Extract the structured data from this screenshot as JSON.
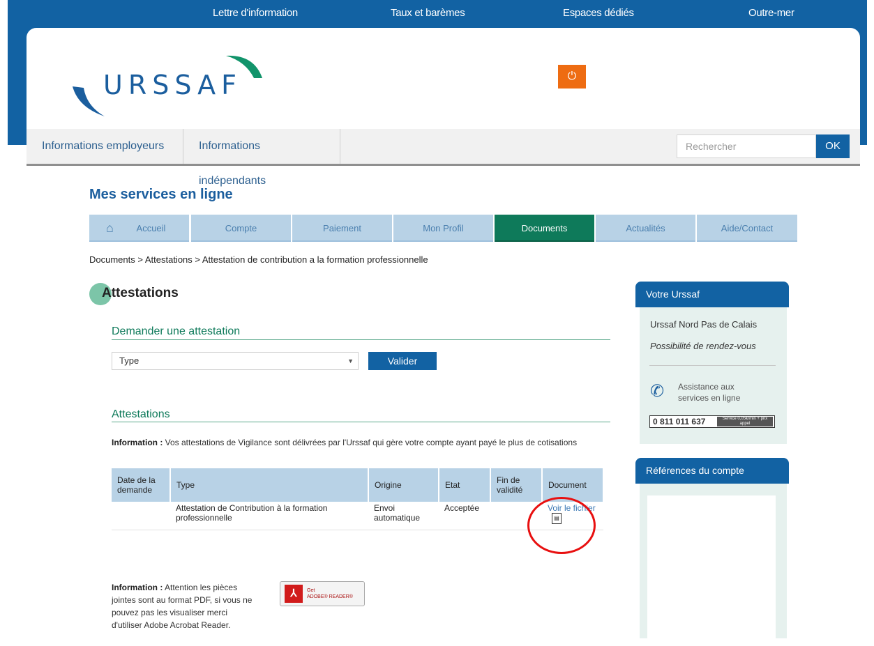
{
  "top_links": [
    "Lettre d'information",
    "Taux et barèmes",
    "Espaces dédiés",
    "Outre-mer"
  ],
  "logo_text": "URSSAF",
  "nav": {
    "employeurs": "Informations employeurs",
    "independants": "Informations indépendants"
  },
  "search": {
    "placeholder": "Rechercher",
    "ok": "OK"
  },
  "page_title": "Mes services en ligne",
  "menu": [
    "Accueil",
    "Compte",
    "Paiement",
    "Mon Profil",
    "Documents",
    "Actualités",
    "Aide/Contact"
  ],
  "menu_active": "Documents",
  "breadcrumb": "Documents > Attestations > Attestation de contribution a la formation professionnelle",
  "section_title": "Attestations",
  "request": {
    "heading": "Demander une attestation",
    "select_value": "Type",
    "button": "Valider"
  },
  "list": {
    "heading": "Attestations",
    "info_label": "Information :",
    "info_text": " Vos attestations de Vigilance sont délivrées par l'Urssaf qui gère votre compte ayant payé le plus de cotisations",
    "columns": [
      "Date de la demande",
      "Type",
      "Origine",
      "Etat",
      "Fin de validité",
      "Document"
    ],
    "rows": [
      {
        "date": "",
        "type": "Attestation de Contribution à la formation professionnelle",
        "origine": "Envoi automatique",
        "etat": "Acceptée",
        "fin": "",
        "document": "Voir le fichier"
      }
    ]
  },
  "pdf_info": {
    "label": "Information :",
    "text": " Attention les pièces jointes sont au format PDF, si vous ne pouvez pas les visualiser merci d'utiliser Adobe Acrobat Reader."
  },
  "adobe": {
    "get": "Get",
    "name": "ADOBE® READER®"
  },
  "sidebar": {
    "votre_urssaf": "Votre Urssaf",
    "agency": "Urssaf Nord Pas de Calais",
    "rdv": "Possibilité de rendez-vous",
    "assistance": "Assistance aux services en ligne",
    "phone": "0 811 011 637",
    "phone_note": "Service 0,05€/min + prix appel",
    "references": "Références du compte"
  }
}
